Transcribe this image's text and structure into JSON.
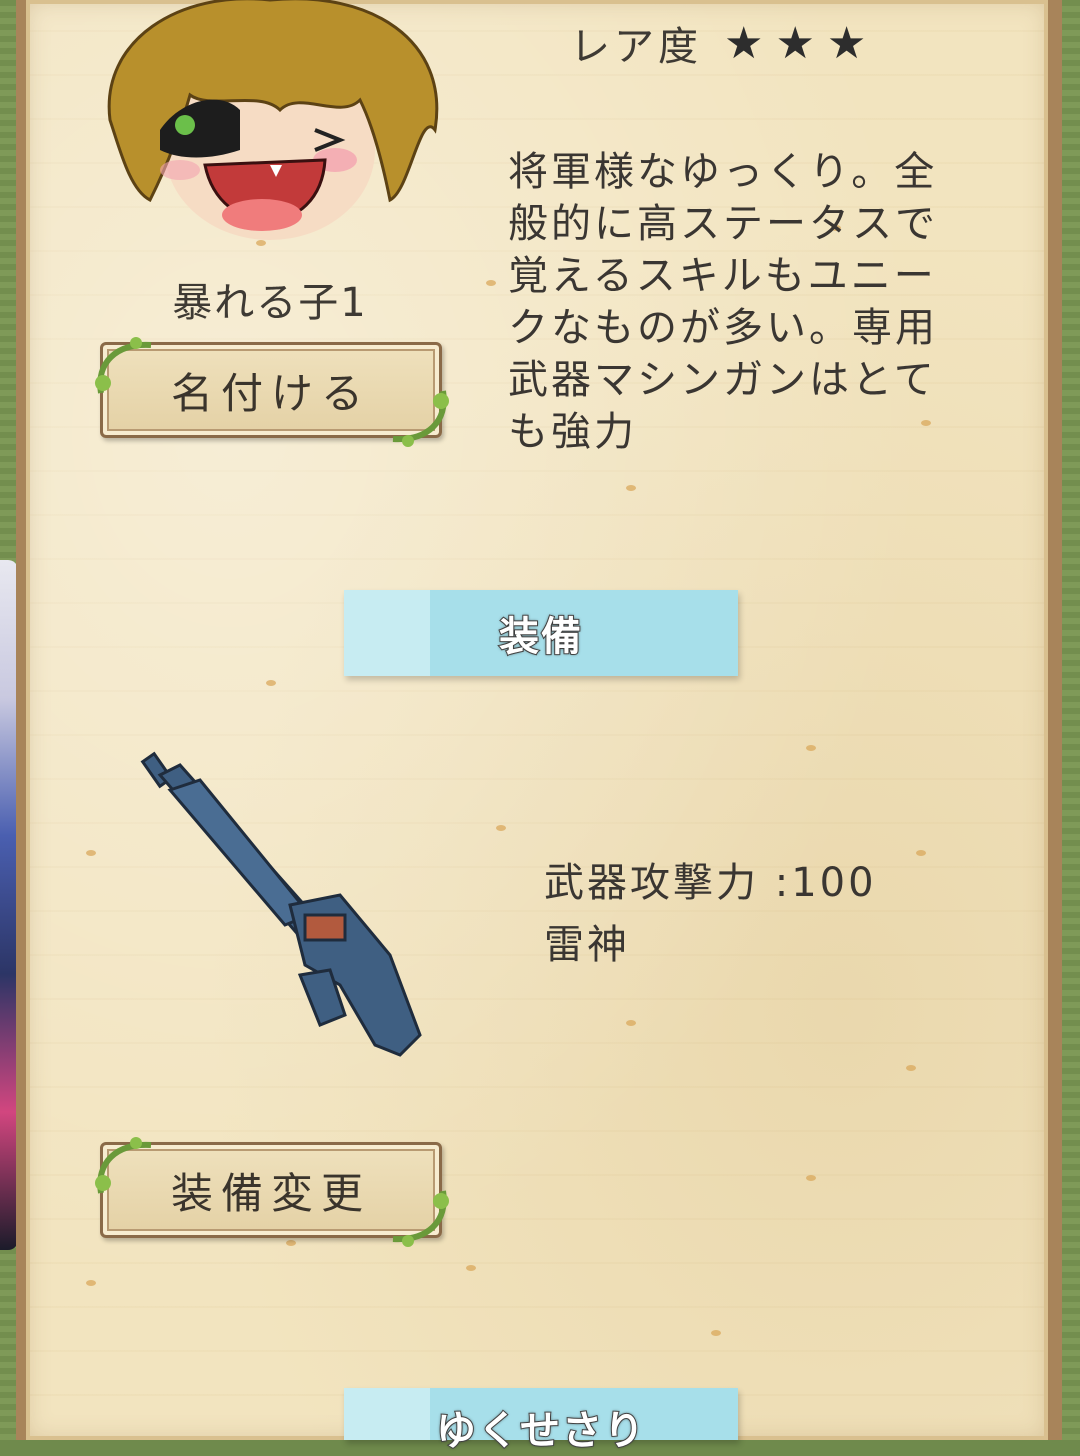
{
  "character": {
    "name": "暴れる子1",
    "rarity_label": "レア度",
    "rarity_stars": 3,
    "description": "将軍様なゆっくり。全般的に高ステータスで覚えるスキルもユニークなものが多い。専用武器マシンガンはとても強力"
  },
  "buttons": {
    "rename_label": "名付ける",
    "change_equipment_label": "装備変更"
  },
  "sections": {
    "equipment_header": "装備",
    "next_header": "ゆくせさり"
  },
  "weapon": {
    "attack_text": "武器攻撃力 :100",
    "name": "雷神"
  },
  "icons": {
    "star": "star-icon",
    "rename_button_vines": "vine-ornament-icon",
    "weapon": "machine-gun-icon"
  },
  "colors": {
    "parchment": "#f2e4bf",
    "header_blue": "#a7dfea",
    "text": "#3a3632"
  }
}
